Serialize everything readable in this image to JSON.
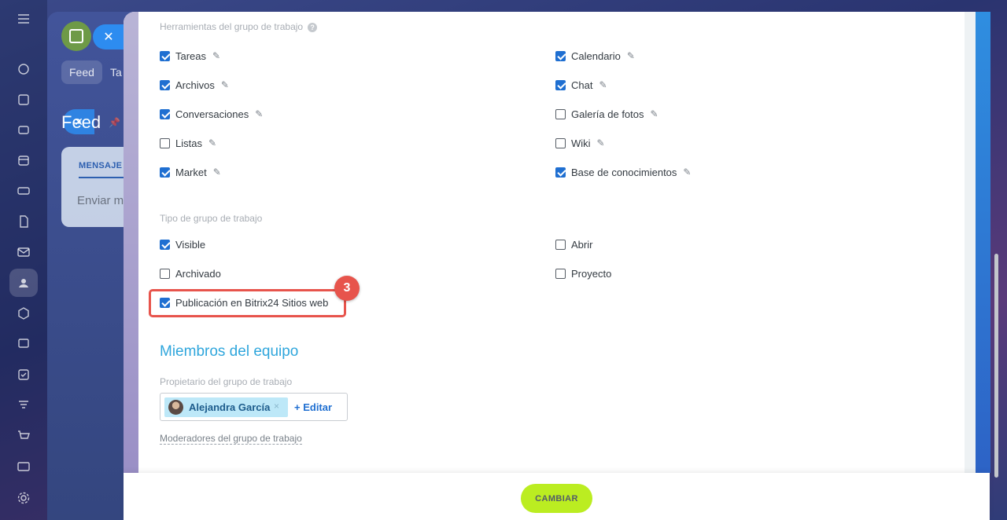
{
  "background": {
    "tabs": [
      "Feed",
      "Ta"
    ],
    "page_title": "Feed",
    "card_tab": "MENSAJE",
    "card_input": "Enviar m"
  },
  "tools": {
    "label": "Herramientas del grupo de trabajo",
    "left": [
      {
        "label": "Tareas",
        "checked": true
      },
      {
        "label": "Archivos",
        "checked": true
      },
      {
        "label": "Conversaciones",
        "checked": true
      },
      {
        "label": "Listas",
        "checked": false
      },
      {
        "label": "Market",
        "checked": true
      }
    ],
    "right": [
      {
        "label": "Calendario",
        "checked": true
      },
      {
        "label": "Chat",
        "checked": true
      },
      {
        "label": "Galería de fotos",
        "checked": false
      },
      {
        "label": "Wiki",
        "checked": false
      },
      {
        "label": "Base de conocimientos",
        "checked": true
      }
    ]
  },
  "type": {
    "label": "Tipo de grupo de trabajo",
    "visible": {
      "label": "Visible",
      "checked": true
    },
    "archived": {
      "label": "Archivado",
      "checked": false
    },
    "publication": {
      "label": "Publicación en Bitrix24 Sitios web",
      "checked": true
    },
    "open": {
      "label": "Abrir",
      "checked": false
    },
    "project": {
      "label": "Proyecto",
      "checked": false
    }
  },
  "step_badge": "3",
  "team": {
    "title": "Miembros del equipo",
    "owner_label": "Propietario del grupo de trabajo",
    "owner_name": "Alejandra García",
    "remove_symbol": "×",
    "edit_label": "+ Editar",
    "moderators_label": "Moderadores del grupo de trabajo"
  },
  "footer": {
    "change_label": "CAMBIAR"
  },
  "colors": {
    "accent_blue": "#1f6fd1",
    "section_title": "#2fa6dc",
    "highlight": "#e7544c",
    "save_button": "#bbed21"
  }
}
